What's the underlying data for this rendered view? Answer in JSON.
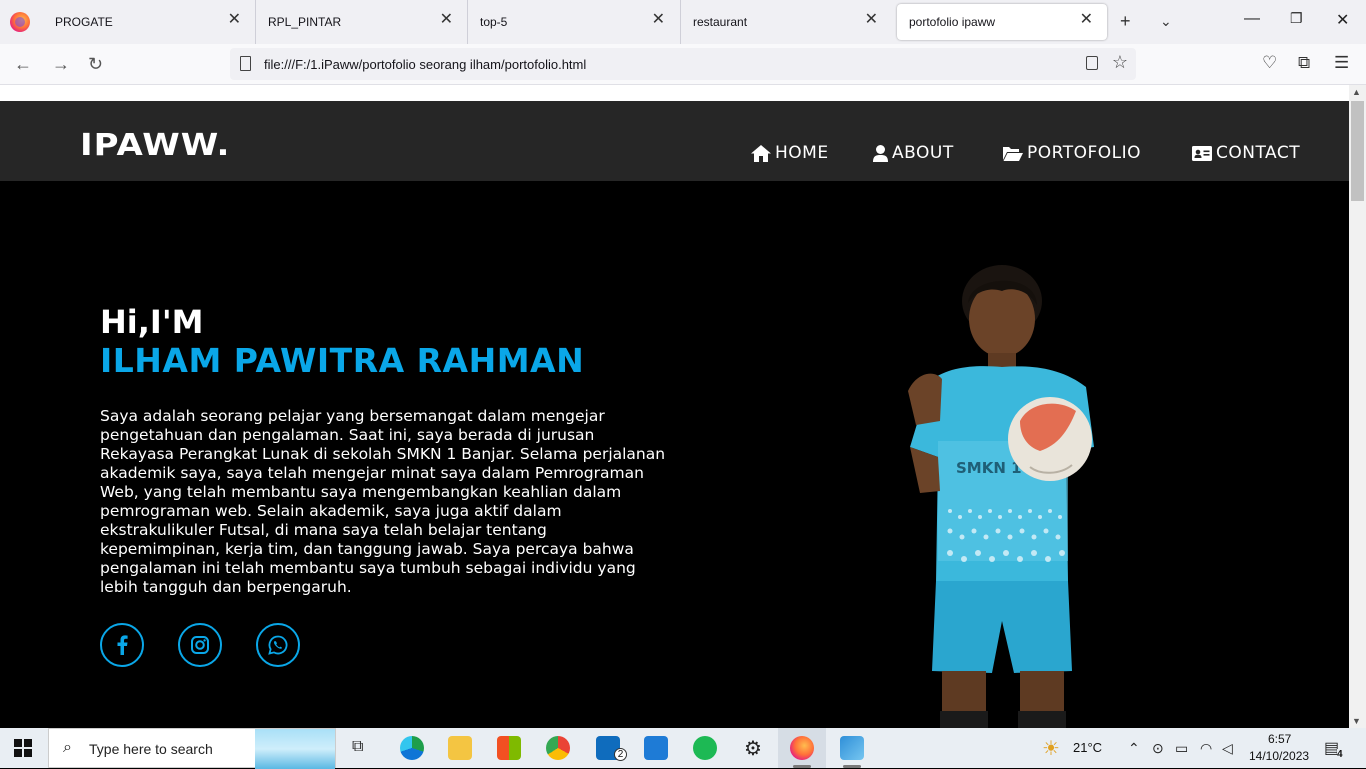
{
  "browser": {
    "tabs": [
      {
        "label": "PROGATE"
      },
      {
        "label": "RPL_PINTAR"
      },
      {
        "label": "top-5"
      },
      {
        "label": "restaurant"
      },
      {
        "label": "portofolio ipaww"
      }
    ],
    "url": "file:///F:/1.iPaww/portofolio seorang ilham/portofolio.html"
  },
  "site": {
    "logo": "IPAWW.",
    "menu": [
      {
        "label": "HOME",
        "icon": "home-icon"
      },
      {
        "label": "ABOUT",
        "icon": "user-icon"
      },
      {
        "label": "PORTOFOLIO",
        "icon": "folder-open-icon"
      },
      {
        "label": "CONTACT",
        "icon": "id-card-icon"
      }
    ],
    "greeting": "Hi,I'M",
    "name": "ILHAM PAWITRA RAHMAN",
    "bio_lines": [
      "Saya adalah seorang pelajar yang bersemangat dalam mengejar",
      "pengetahuan dan pengalaman. Saat ini, saya berada di jurusan",
      "Rekayasa Perangkat Lunak di sekolah SMKN 1 Banjar. Selama perjalanan",
      "akademik saya, saya telah mengejar minat saya dalam Pemrograman",
      "Web, yang telah membantu saya mengembangkan keahlian dalam",
      "pemrograman web. Selain akademik, saya juga aktif dalam",
      "ekstrakulikuler Futsal, di mana saya telah belajar tentang",
      "kepemimpinan, kerja tim, dan tanggung jawab. Saya percaya bahwa",
      "pengalaman ini telah membantu saya tumbuh sebagai individu yang",
      "lebih tangguh dan berpengaruh."
    ],
    "social": [
      "facebook-icon",
      "instagram-icon",
      "whatsapp-icon"
    ],
    "jersey_text": "SMKN 1 BA",
    "accent_color": "#0aa7e8",
    "header_color": "#262626"
  },
  "taskbar": {
    "search_placeholder": "Type here to search",
    "weather": "21°C",
    "time": "6:57",
    "date": "14/10/2023",
    "mail_badge": "2",
    "notification_count": "4"
  }
}
